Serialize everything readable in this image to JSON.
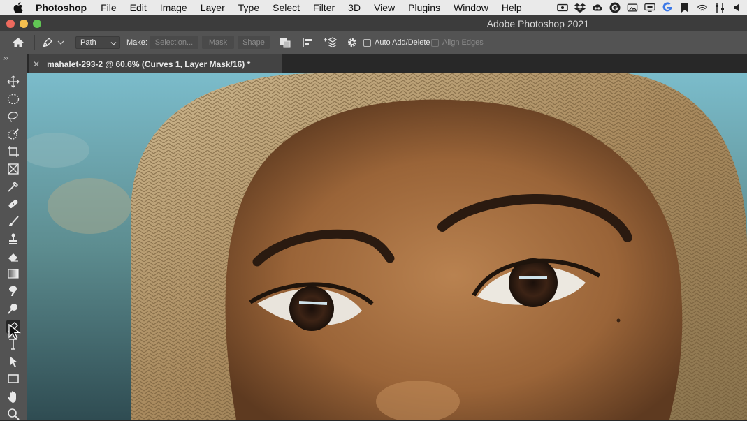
{
  "menubar": {
    "app": "Photoshop",
    "items": [
      "File",
      "Edit",
      "Image",
      "Layer",
      "Type",
      "Select",
      "Filter",
      "3D",
      "View",
      "Plugins",
      "Window",
      "Help"
    ],
    "status_icons": [
      "screen-record-icon",
      "dropbox-icon",
      "creative-cloud-icon",
      "grammarly-icon",
      "photos-icon",
      "display-icon",
      "google-icon",
      "bookmark-icon",
      "wifi-icon",
      "control-center-icon",
      "volume-icon"
    ]
  },
  "window": {
    "title": "Adobe Photoshop 2021"
  },
  "options": {
    "mode": "Path",
    "make_label": "Make:",
    "selection_label": "Selection...",
    "mask_label": "Mask",
    "shape_label": "Shape",
    "auto_add_delete": "Auto Add/Delete",
    "align_edges": "Align Edges"
  },
  "document": {
    "tab_title": "mahalet-293-2 @ 60.6% (Curves 1, Layer Mask/16) *"
  },
  "tools": [
    "move",
    "marquee",
    "lasso",
    "quick-selection",
    "crop",
    "frame",
    "eyedropper",
    "healing-brush",
    "brush",
    "clone-stamp",
    "eraser",
    "gradient",
    "smudge",
    "dodge",
    "pen",
    "type",
    "path-selection",
    "rectangle",
    "hand",
    "zoom"
  ],
  "active_tool": "pen",
  "colors": {
    "menubar_bg": "#eaeaea",
    "panel_bg": "#535353",
    "app_bg": "#282828",
    "active_tab": "#434343"
  }
}
